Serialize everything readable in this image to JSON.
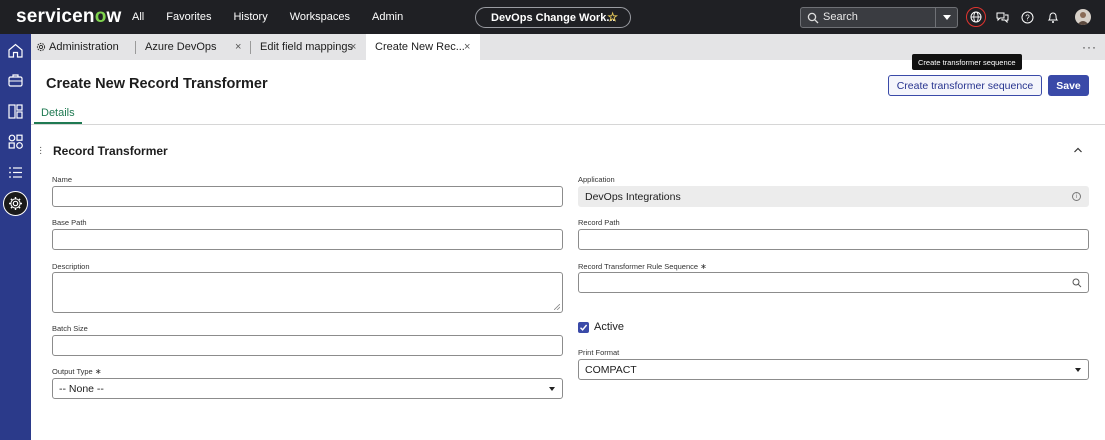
{
  "topnav": {
    "logo": {
      "pre": "servicen",
      "o": "o",
      "post": "w"
    },
    "menu": [
      "All",
      "Favorites",
      "History",
      "Workspaces",
      "Admin"
    ],
    "context_title": "DevOps Change Work...",
    "search_label": "Search",
    "accent_highlight": "#e0342f"
  },
  "tabs": [
    {
      "label": "Administration",
      "closable": false
    },
    {
      "label": "Azure DevOps",
      "closable": true
    },
    {
      "label": "Edit field mappings",
      "closable": true
    },
    {
      "label": "Create New Rec...",
      "closable": true,
      "active": true
    }
  ],
  "tab_close_glyph": "×",
  "tooltip": "Create transformer sequence",
  "page": {
    "title": "Create New Record Transformer",
    "create_seq_button": "Create transformer sequence",
    "save_button": "Save",
    "details_tab": "Details"
  },
  "section": {
    "title": "Record Transformer"
  },
  "form": {
    "name": {
      "label": "Name",
      "value": ""
    },
    "base_path": {
      "label": "Base Path",
      "value": ""
    },
    "description": {
      "label": "Description",
      "value": ""
    },
    "batch_size": {
      "label": "Batch Size",
      "value": ""
    },
    "output_type": {
      "label": "Output Type",
      "value": "-- None --",
      "required": "∗"
    },
    "application": {
      "label": "Application",
      "value": "DevOps Integrations"
    },
    "record_path": {
      "label": "Record Path",
      "value": ""
    },
    "rule_sequence": {
      "label": "Record Transformer Rule Sequence",
      "value": "",
      "required": "∗"
    },
    "active": {
      "label": "Active",
      "checked": true
    },
    "print_format": {
      "label": "Print Format",
      "value": "COMPACT"
    }
  },
  "colors": {
    "nav_bg": "#1f2024",
    "rail_bg": "#2b3a8a",
    "primary": "#3a4aa8",
    "details_green": "#1f7a52"
  }
}
